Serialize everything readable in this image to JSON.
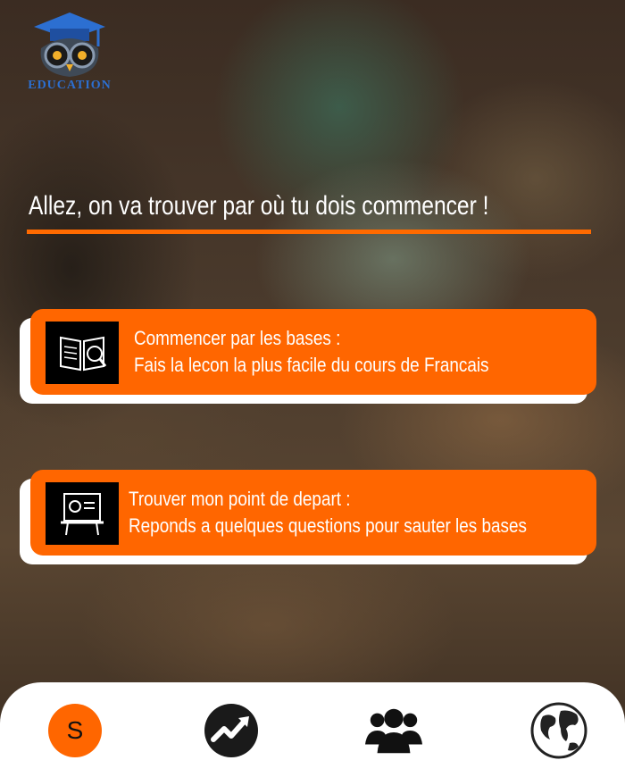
{
  "logo": {
    "text": "EDUCATION"
  },
  "headline": "Allez, on va trouver par où tu dois commencer !",
  "options": [
    {
      "line1": "Commencer par les bases :",
      "line2": " Fais la lecon la plus facile du cours de Francais",
      "icon": "open-book-icon"
    },
    {
      "line1": "Trouver mon point de depart :",
      "line2": "Reponds a quelques questions pour sauter les bases",
      "icon": "presentation-board-icon"
    }
  ],
  "nav": {
    "avatar_letter": "S",
    "items": [
      "profile-avatar",
      "progress-chart-icon",
      "community-users-icon",
      "globe-icon"
    ]
  },
  "colors": {
    "accent": "#ff6600",
    "text_light": "#ffffff",
    "logo_blue": "#2c6fd1"
  }
}
